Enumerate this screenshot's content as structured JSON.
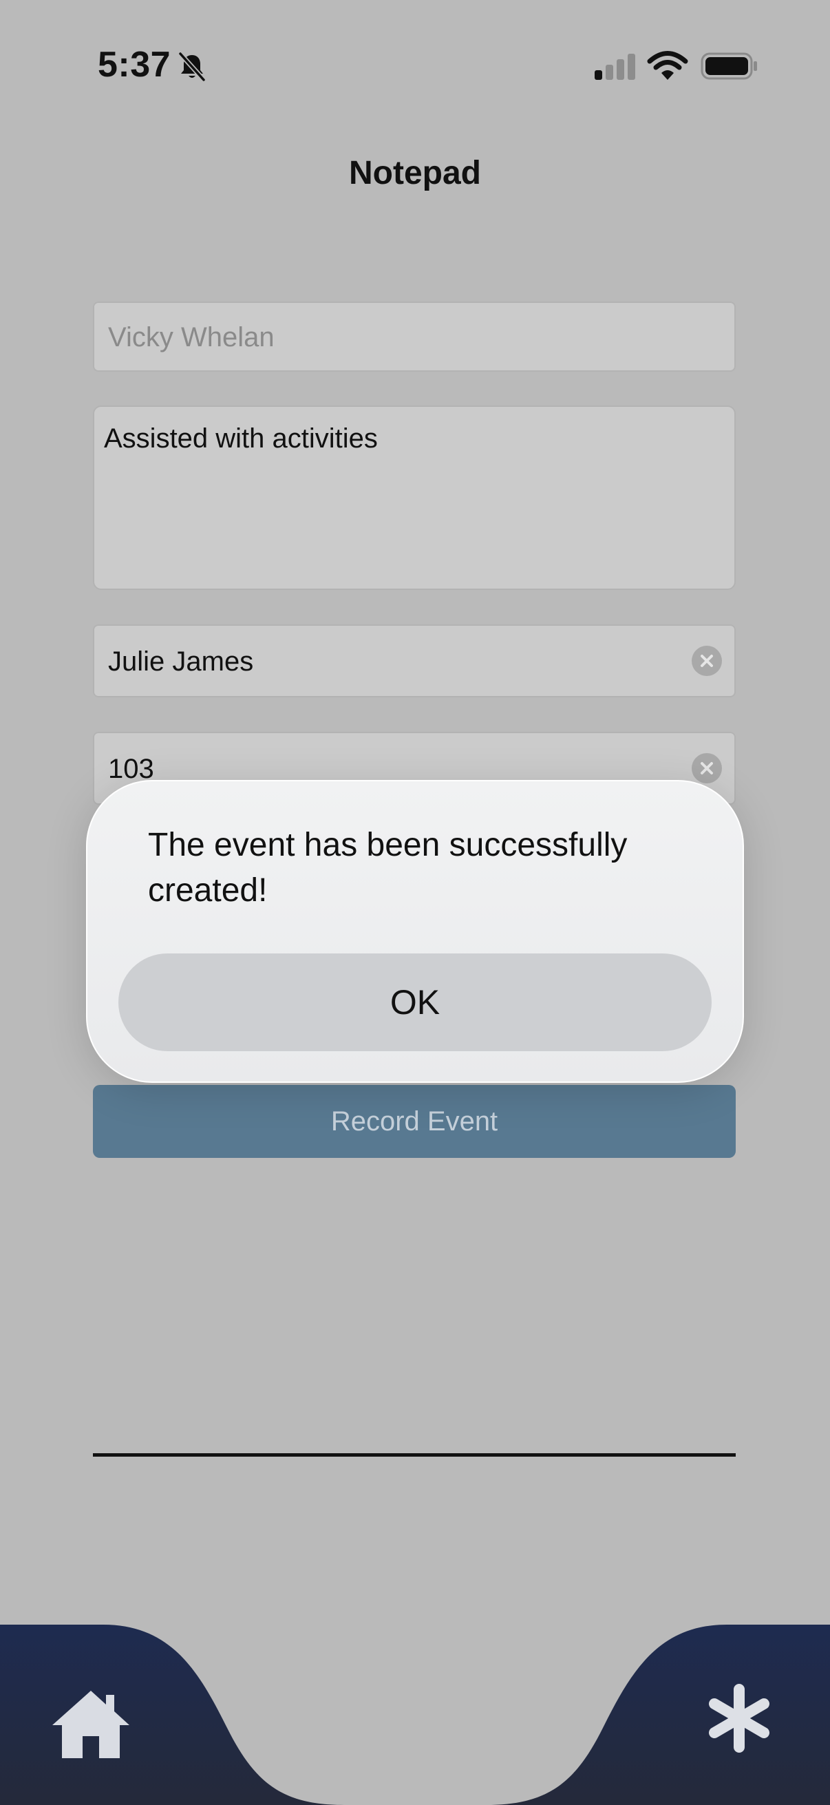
{
  "status_bar": {
    "time": "5:37",
    "mute_icon": "bell-slash-icon",
    "signal_icon": "cellular-signal-icon",
    "wifi_icon": "wifi-icon",
    "battery_icon": "battery-icon"
  },
  "header": {
    "title": "Notepad"
  },
  "form": {
    "name_field": {
      "placeholder": "Vicky Whelan"
    },
    "notes_field": {
      "value": "Assisted with activities"
    },
    "staff_field": {
      "value": "Julie James"
    },
    "room_field": {
      "value": "103"
    },
    "record_button_label": "Record Event"
  },
  "alert": {
    "message": "The event has been successfully created!",
    "ok_label": "OK"
  },
  "bottom_nav": {
    "home_icon": "home-icon",
    "more_icon": "asterisk-icon",
    "background_color": "#1e2b4f"
  },
  "colors": {
    "background": "#bababa",
    "record_button": "#587991",
    "alert_background": "#eeeff0"
  }
}
